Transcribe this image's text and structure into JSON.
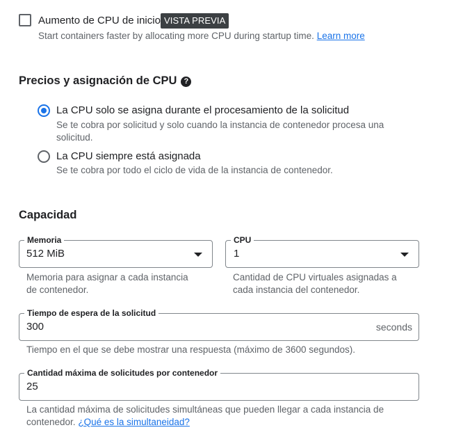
{
  "startup_boost": {
    "checked": false,
    "label": "Aumento de CPU de inicio",
    "badge": "VISTA PREVIA",
    "help_text": "Start containers faster by allocating more CPU during startup time.",
    "learn_more": "Learn more"
  },
  "cpu_allocation": {
    "title": "Precios y asignación de CPU",
    "help_icon": "help-icon",
    "options": [
      {
        "label": "La CPU solo se asigna durante el procesamiento de la solicitud",
        "description_line1": "Se te cobra por solicitud y solo cuando la instancia de contenedor procesa una",
        "description_line2": "solicitud.",
        "selected": true
      },
      {
        "label": "La CPU siempre está asignada",
        "description": "Se te cobra por todo el ciclo de vida de la instancia de contenedor.",
        "selected": false
      }
    ]
  },
  "capacity": {
    "title": "Capacidad",
    "memory": {
      "label": "Memoria",
      "value": "512 MiB",
      "hint_line1": "Memoria para asignar a cada instancia",
      "hint_line2": "de contenedor."
    },
    "cpu": {
      "label": "CPU",
      "value": "1",
      "hint_line1": "Cantidad de CPU virtuales asignadas a",
      "hint_line2": "cada instancia del contenedor."
    },
    "timeout": {
      "label": "Tiempo de espera de la solicitud",
      "value": "300",
      "suffix": "seconds",
      "hint": "Tiempo en el que se debe mostrar una respuesta (máximo de 3600 segundos)."
    },
    "concurrency": {
      "label": "Cantidad máxima de solicitudes por contenedor",
      "value": "25",
      "hint_line1": "La cantidad máxima de solicitudes simultáneas que pueden llegar a cada instancia de",
      "hint_line2_prefix": "contenedor.",
      "hint_link": "¿Qué es la simultaneidad?"
    }
  },
  "colors": {
    "accent": "#1a73e8",
    "text": "#202124",
    "secondary_text": "#5f6368",
    "badge_bg": "#3c4043",
    "border": "#80868b"
  }
}
